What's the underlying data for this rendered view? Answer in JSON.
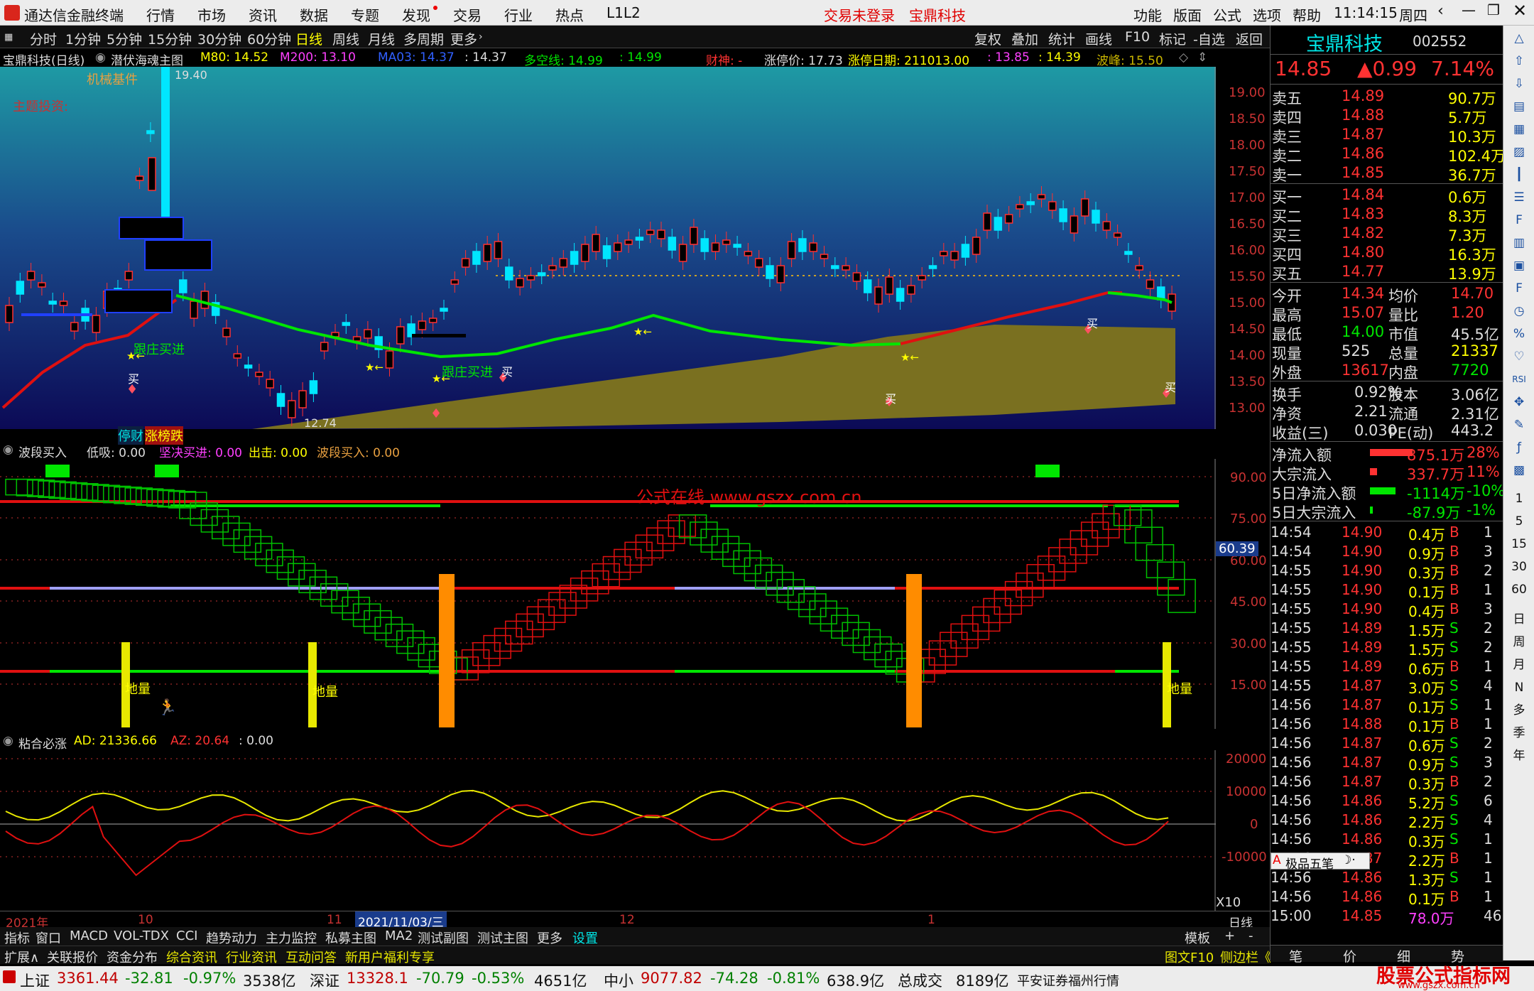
{
  "menu": {
    "app_title": "通达信金融终端",
    "items": [
      "行情",
      "市场",
      "资讯",
      "数据",
      "专题",
      "发现",
      "交易",
      "行业",
      "热点",
      "L1L2"
    ],
    "login": "交易未登录",
    "stock": "宝鼎科技",
    "right": [
      "功能",
      "版面",
      "公式",
      "选项",
      "帮助"
    ],
    "time": "11:14:15",
    "weekday": "周四"
  },
  "toolbar": {
    "periods": [
      "分时",
      "1分钟",
      "5分钟",
      "15分钟",
      "30分钟",
      "60分钟",
      "日线",
      "周线",
      "月线",
      "多周期",
      "更多"
    ],
    "active": "日线",
    "tools": [
      "复权",
      "叠加",
      "统计",
      "画线",
      "F10",
      "标记",
      "-自选",
      "返回"
    ]
  },
  "main_info": {
    "name": "宝鼎科技(日线)",
    "formula": "潜伏海魂主图",
    "m80": "M80: 14.52",
    "m200": "M200: 13.10",
    "ma03": "MA03: 14.37",
    "v1": ": 14.37",
    "dkx": "多空线: 14.99",
    "v2": ": 14.99",
    "caishen": "财神: -",
    "limit": "涨停价: 17.73",
    "limit_date": "涨停日期: 211013.00",
    "v3": ": 13.85",
    "v4": ": 14.39",
    "wave": "波峰: 15.50"
  },
  "main_chart": {
    "y_ticks": [
      "19.00",
      "18.50",
      "18.00",
      "17.50",
      "17.00",
      "16.50",
      "16.00",
      "15.50",
      "15.00",
      "14.50",
      "14.00",
      "13.50",
      "13.00"
    ],
    "label_sector": "机械基件",
    "label_theme": "主题投资:",
    "high_label": "19.40",
    "low_label": "12.74",
    "follow1": "跟庄买进",
    "follow2": "跟庄买进",
    "buy_mark": "买",
    "badges": [
      "停",
      "财",
      "涨",
      "榜",
      "跌"
    ]
  },
  "panel2": {
    "name": "波段买入",
    "low": "低吸: 0.00",
    "firm": "坚决买进: 0.00",
    "out": "出击: 0.00",
    "wave": "波段买入: 0.00",
    "y_ticks": [
      "90.00",
      "75.00",
      "60.00",
      "45.00",
      "30.00",
      "15.00"
    ],
    "current": "60.39",
    "watermark": "公式在线 www.gszx.com.cn",
    "dl": "地量"
  },
  "panel3": {
    "name": "粘合必涨",
    "ad": "AD: 21336.66",
    "az": "AZ: 20.64",
    "zero": ": 0.00",
    "y_ticks": [
      "20000",
      "10000",
      "0",
      "-10000"
    ],
    "x10": "X10"
  },
  "x_axis": {
    "y2021": "2021年",
    "m10": "10",
    "m11": "11",
    "cursor_date": "2021/11/03/三",
    "m12": "12",
    "m1": "1",
    "period": "日线"
  },
  "quote": {
    "name": "宝鼎科技",
    "code": "002552",
    "price": "14.85",
    "change": "▲0.99",
    "pct": "7.14%",
    "asks": [
      [
        "卖五",
        "14.89",
        "90.7万"
      ],
      [
        "卖四",
        "14.88",
        "5.7万"
      ],
      [
        "卖三",
        "14.87",
        "10.3万"
      ],
      [
        "卖二",
        "14.86",
        "102.4万"
      ],
      [
        "卖一",
        "14.85",
        "36.7万"
      ]
    ],
    "bids": [
      [
        "买一",
        "14.84",
        "0.6万"
      ],
      [
        "买二",
        "14.83",
        "8.3万"
      ],
      [
        "买三",
        "14.82",
        "7.3万"
      ],
      [
        "买四",
        "14.80",
        "16.3万"
      ],
      [
        "买五",
        "14.77",
        "13.9万"
      ]
    ],
    "stats": [
      [
        "今开",
        "14.34",
        "均价",
        "14.70"
      ],
      [
        "最高",
        "15.07",
        "量比",
        "1.20"
      ],
      [
        "最低",
        "14.00",
        "市值",
        "45.5亿"
      ],
      [
        "现量",
        "525",
        "总量",
        "21337"
      ],
      [
        "外盘",
        "13617",
        "内盘",
        "7720"
      ]
    ],
    "fund": [
      [
        "换手",
        "0.92%",
        "股本",
        "3.06亿"
      ],
      [
        "净资",
        "2.21",
        "流通",
        "2.31亿"
      ],
      [
        "收益(三)",
        "0.030",
        "PE(动)",
        "443.2"
      ]
    ],
    "flows": [
      [
        "净流入额",
        "875.1万",
        "28%"
      ],
      [
        "大宗流入",
        "337.7万",
        "11%"
      ],
      [
        "5日净流入额",
        "-1114万",
        "-10%"
      ],
      [
        "5日大宗流入",
        "-87.9万",
        "-1%"
      ]
    ]
  },
  "ticks": [
    [
      "14:54",
      "14.90",
      "0.4万",
      "B",
      "1"
    ],
    [
      "14:54",
      "14.90",
      "0.9万",
      "B",
      "3"
    ],
    [
      "14:55",
      "14.90",
      "0.3万",
      "B",
      "2"
    ],
    [
      "14:55",
      "14.90",
      "0.1万",
      "B",
      "1"
    ],
    [
      "14:55",
      "14.90",
      "0.4万",
      "B",
      "3"
    ],
    [
      "14:55",
      "14.89",
      "1.5万",
      "S",
      "2"
    ],
    [
      "14:55",
      "14.89",
      "1.5万",
      "S",
      "2"
    ],
    [
      "14:55",
      "14.89",
      "0.6万",
      "B",
      "1"
    ],
    [
      "14:55",
      "14.87",
      "3.0万",
      "S",
      "4"
    ],
    [
      "14:56",
      "14.87",
      "0.1万",
      "S",
      "1"
    ],
    [
      "14:56",
      "14.88",
      "0.1万",
      "B",
      "1"
    ],
    [
      "14:56",
      "14.87",
      "0.6万",
      "S",
      "2"
    ],
    [
      "14:56",
      "14.87",
      "0.9万",
      "S",
      "3"
    ],
    [
      "14:56",
      "14.87",
      "0.3万",
      "B",
      "2"
    ],
    [
      "14:56",
      "14.86",
      "5.2万",
      "S",
      "6"
    ],
    [
      "14:56",
      "14.86",
      "2.2万",
      "S",
      "4"
    ],
    [
      "14:56",
      "14.86",
      "0.3万",
      "S",
      "1"
    ],
    [
      "14:56",
      "14.87",
      "2.2万",
      "B",
      "1"
    ],
    [
      "14:56",
      "14.86",
      "1.3万",
      "S",
      "1"
    ],
    [
      "14:56",
      "14.86",
      "0.1万",
      "B",
      "1"
    ],
    [
      "15:00",
      "14.85",
      "78.0万",
      "",
      "46"
    ]
  ],
  "popup": "极品五笔",
  "bottom_tabs": [
    "指标",
    "窗口",
    "MACD",
    "VOL-TDX",
    "CCI",
    "趋势动力",
    "主力监控",
    "私募主图",
    "MA2",
    "测试副图",
    "测试主图",
    "更多",
    "设置"
  ],
  "bottom_right": [
    "模板",
    "+",
    "-"
  ],
  "bottom_tabs2": [
    "扩展∧",
    "关联报价",
    "资金分布",
    "综合资讯",
    "行业资讯",
    "互动问答",
    "新用户福利专享"
  ],
  "bottom_right2": [
    "图文F10",
    "侧边栏《"
  ],
  "right_tabs": [
    "笔",
    "价",
    "细",
    "势"
  ],
  "side_tabs": [
    "1",
    "5",
    "15",
    "30",
    "60",
    "日",
    "周",
    "月",
    "N",
    "多",
    "季",
    "年"
  ],
  "status": {
    "sh": "上证",
    "sh_v": "3361.44",
    "sh_c": "-32.81",
    "sh_p": "-0.97%",
    "sh_a": "3538亿",
    "sz": "深证",
    "sz_v": "13328.1",
    "sz_c": "-70.79",
    "sz_p": "-0.53%",
    "sz_a": "4651亿",
    "zx": "中小",
    "zx_v": "9077.82",
    "zx_c": "-74.28",
    "zx_p": "-0.81%",
    "zx_a": "638.9亿",
    "total": "总成交",
    "total_v": "8189亿",
    "broker": "平安证券福州行情",
    "site_name": "股票公式指标网",
    "site_url": "www.gszx.com.cn"
  },
  "colors": {
    "up": "#ff3232",
    "down": "#00e600",
    "yellow": "#ffff00",
    "cyan": "#00e6e6",
    "bg": "#000000"
  }
}
